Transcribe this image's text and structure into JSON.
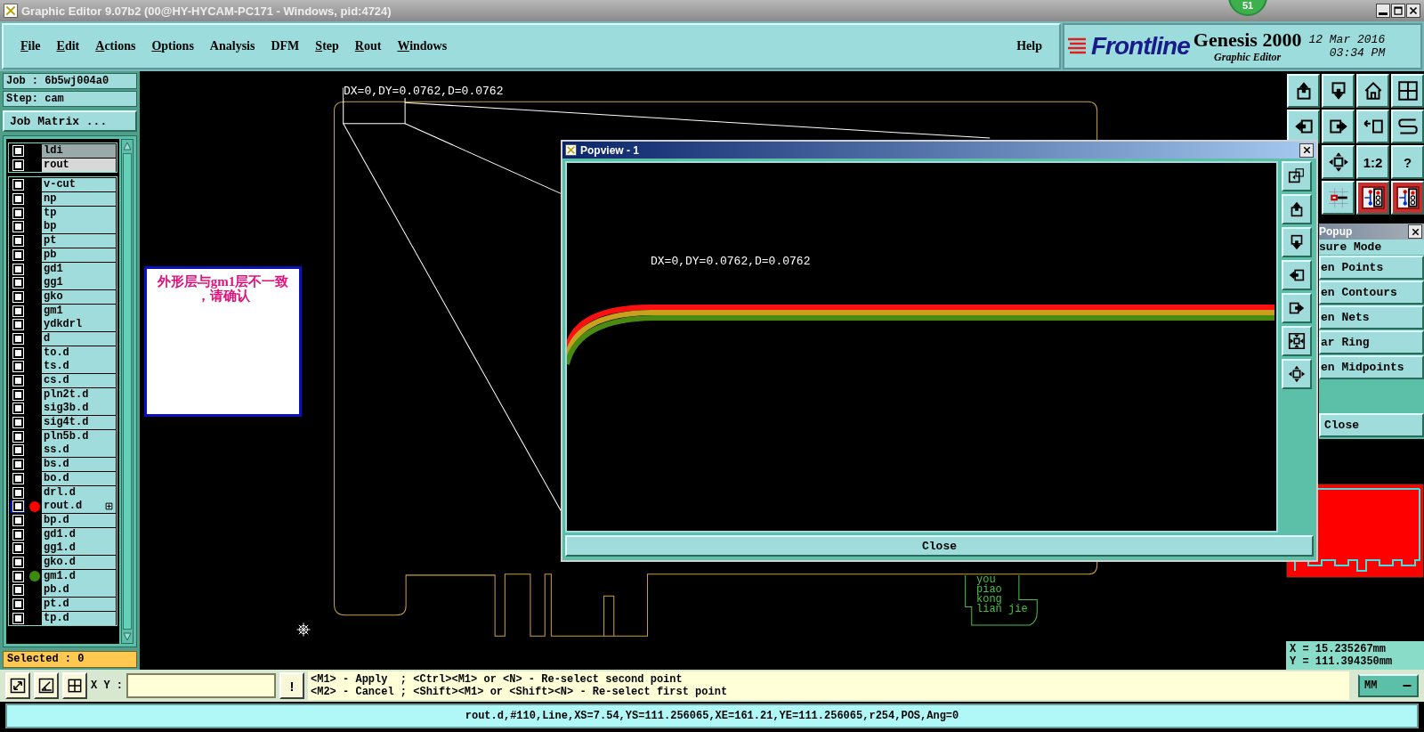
{
  "window": {
    "title": "Graphic Editor 9.07b2 (00@HY-HYCAM-PC171 - Windows, pid:4724)",
    "badge": "51"
  },
  "menu": [
    {
      "label": "File",
      "mnemonic": true
    },
    {
      "label": "Edit",
      "mnemonic": true
    },
    {
      "label": "Actions",
      "mnemonic": true
    },
    {
      "label": "Options",
      "mnemonic": true
    },
    {
      "label": "Analysis",
      "mnemonic": false
    },
    {
      "label": "DFM",
      "mnemonic": false
    },
    {
      "label": "Step",
      "mnemonic": true
    },
    {
      "label": "Rout",
      "mnemonic": true
    },
    {
      "label": "Windows",
      "mnemonic": true
    }
  ],
  "help": "Help",
  "branding": {
    "logo": "Frontline",
    "product": "Genesis 2000",
    "subtitle": "Graphic Editor",
    "date": "12 Mar 2016",
    "time": "03:34 PM"
  },
  "job_panel": {
    "job": "Job : 6b5wj004a0",
    "step": "Step: cam",
    "matrix_button": "Job Matrix ...",
    "selected": "Selected : 0"
  },
  "fixed_layers": [
    {
      "name": "ldi",
      "highlighted": true,
      "checked": false
    },
    {
      "name": "rout",
      "highlighted": false,
      "checked": false
    }
  ],
  "layers": [
    {
      "name": "v-cut",
      "checked": false,
      "focused": false,
      "flagged": false
    },
    {
      "name": "np",
      "checked": false,
      "focused": false,
      "flagged": false
    },
    {
      "name": "tp",
      "checked": false,
      "focused": false,
      "flagged": false
    },
    {
      "name": "bp",
      "checked": false,
      "focused": false,
      "flagged": false
    },
    {
      "name": "pt",
      "checked": false,
      "focused": false,
      "flagged": false
    },
    {
      "name": "pb",
      "checked": false,
      "focused": false,
      "flagged": false
    },
    {
      "name": "gd1",
      "checked": false,
      "focused": false,
      "flagged": false
    },
    {
      "name": "gg1",
      "checked": false,
      "focused": false,
      "flagged": false
    },
    {
      "name": "gko",
      "checked": false,
      "focused": false,
      "flagged": false
    },
    {
      "name": "gm1",
      "checked": false,
      "focused": false,
      "flagged": false
    },
    {
      "name": "ydkdrl",
      "checked": false,
      "focused": false,
      "flagged": false
    },
    {
      "name": "d",
      "checked": false,
      "focused": false,
      "flagged": false
    },
    {
      "name": "to.d",
      "checked": false,
      "focused": false,
      "flagged": false
    },
    {
      "name": "ts.d",
      "checked": false,
      "focused": false,
      "flagged": false
    },
    {
      "name": "cs.d",
      "checked": false,
      "focused": false,
      "flagged": false
    },
    {
      "name": "pln2t.d",
      "checked": false,
      "focused": false,
      "flagged": false
    },
    {
      "name": "sig3b.d",
      "checked": false,
      "focused": false,
      "flagged": false
    },
    {
      "name": "sig4t.d",
      "checked": false,
      "focused": false,
      "flagged": false
    },
    {
      "name": "pln5b.d",
      "checked": false,
      "focused": false,
      "flagged": false
    },
    {
      "name": "ss.d",
      "checked": false,
      "focused": false,
      "flagged": false
    },
    {
      "name": "bs.d",
      "checked": false,
      "focused": false,
      "flagged": false
    },
    {
      "name": "bo.d",
      "checked": false,
      "focused": false,
      "flagged": false
    },
    {
      "name": "drl.d",
      "checked": false,
      "focused": false,
      "flagged": false
    },
    {
      "name": "rout.d",
      "checked": false,
      "focused": true,
      "flagged": true,
      "color": "#ff0000"
    },
    {
      "name": "bp.d",
      "checked": false,
      "focused": false,
      "flagged": false
    },
    {
      "name": "gd1.d",
      "checked": false,
      "focused": false,
      "flagged": false
    },
    {
      "name": "gg1.d",
      "checked": false,
      "focused": false,
      "flagged": false
    },
    {
      "name": "gko.d",
      "checked": false,
      "focused": false,
      "flagged": false
    },
    {
      "name": "gm1.d",
      "checked": false,
      "focused": false,
      "flagged": false,
      "color": "#3a8c10"
    },
    {
      "name": "pb.d",
      "checked": false,
      "focused": false,
      "flagged": false
    },
    {
      "name": "pt.d",
      "checked": false,
      "focused": false,
      "flagged": false
    },
    {
      "name": "tp.d",
      "checked": false,
      "focused": false,
      "flagged": false
    }
  ],
  "canvas": {
    "measure_label": "DX=0,DY=0.0762,D=0.0762",
    "note": [
      "外形层与gm1层不一致",
      "，请确认"
    ],
    "board_text": [
      "you",
      "piao",
      "kong",
      "lian jie"
    ]
  },
  "popview": {
    "title": "Popview - 1",
    "measure_label": "DX=0,DY=0.0762,D=0.0762",
    "close": "Close"
  },
  "toolbar_labels": [
    "1:2",
    "?"
  ],
  "measure_popup": {
    "title": "Popup",
    "heading": "sure Mode",
    "options": [
      "en Points",
      "en Contours",
      "en Nets",
      "ar Ring",
      "en Midpoints"
    ],
    "close": "Close"
  },
  "coordinates": {
    "x": "X = 15.235267mm",
    "y": "Y = 111.394350mm"
  },
  "command": {
    "xy_label": "X Y :",
    "alert_button": "!",
    "prompt": [
      "<M1> - Apply  ; <Ctrl><M1> or <N> - Re-select second point",
      "<M2> - Cancel ; <Shift><M1> or <Shift><N> - Re-select first point"
    ],
    "units": "MM"
  },
  "status": "rout.d,#110,Line,XS=7.54,YS=111.256065,XE=161.21,YE=111.256065,r254,POS,Ang=0"
}
